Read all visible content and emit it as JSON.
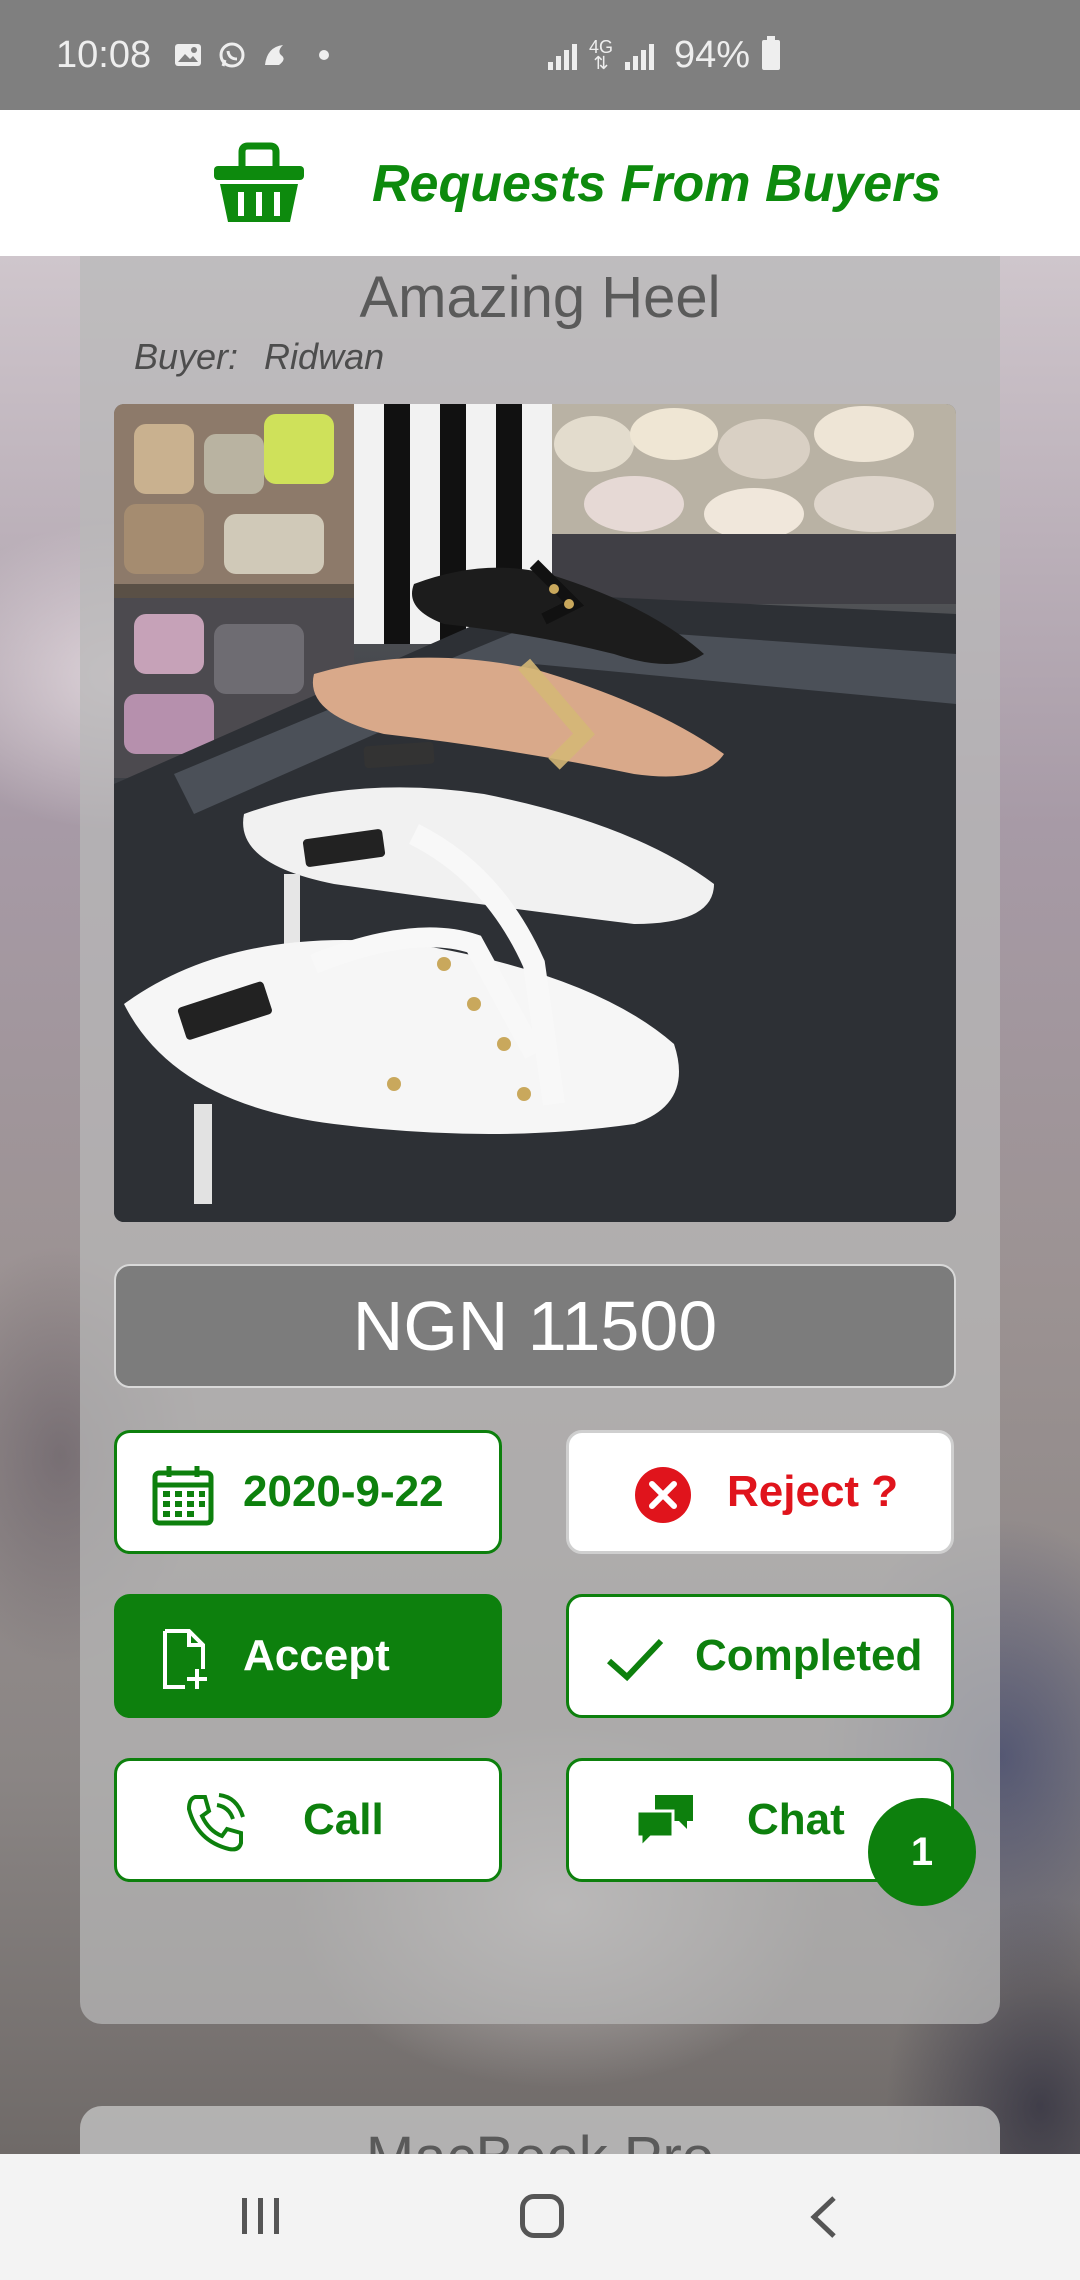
{
  "status_bar": {
    "time": "10:08",
    "network": "4G",
    "battery": "94%"
  },
  "header": {
    "title": "Requests From Buyers",
    "icon": "basket-icon"
  },
  "request": {
    "product_name": "Amazing Heel",
    "buyer_label": "Buyer:",
    "buyer_name": "Ridwan",
    "price": "NGN 11500",
    "date": "2020-9-22",
    "reject_label": "Reject ?",
    "accept_label": "Accept",
    "completed_label": "Completed",
    "call_label": "Call",
    "chat_label": "Chat",
    "chat_badge": "1"
  },
  "next_request": {
    "product_name": "MacBook Pro"
  },
  "colors": {
    "accent": "#0d800d",
    "danger": "#e0141c",
    "price_bg": "#7c7c7c"
  }
}
